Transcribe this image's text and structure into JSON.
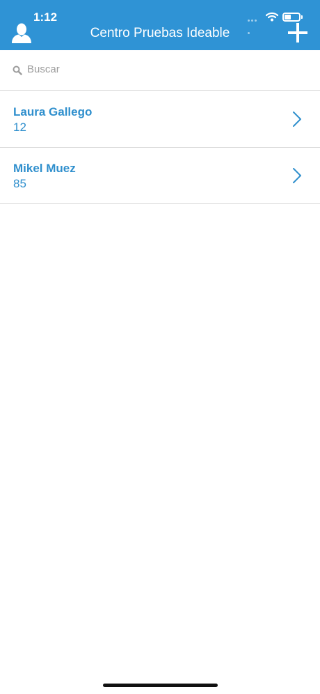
{
  "status_bar": {
    "time": "1:12",
    "battery_level": 0.45
  },
  "header": {
    "title": "Centro Pruebas Ideable",
    "icons": {
      "left": "user-icon",
      "right": "plus-icon"
    }
  },
  "search": {
    "placeholder": "Buscar"
  },
  "contacts": [
    {
      "name": "Laura Gallego",
      "value": "12"
    },
    {
      "name": "Mikel Muez",
      "value": "85"
    }
  ],
  "colors": {
    "header": "#2f93d5",
    "accent": "#2f8fcd"
  }
}
